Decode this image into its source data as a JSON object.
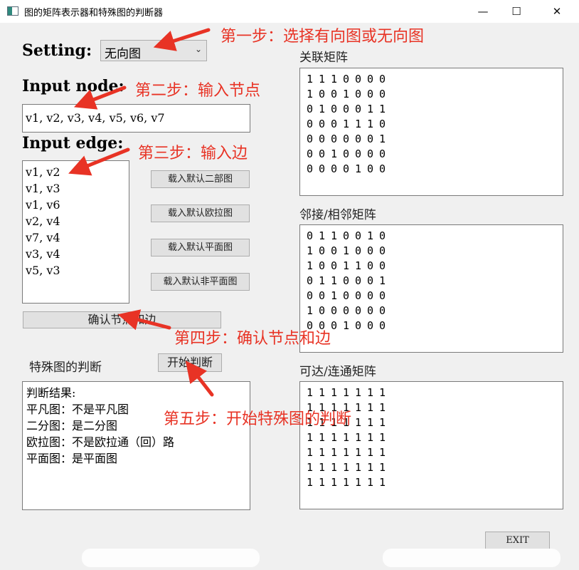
{
  "window": {
    "title": "图的矩阵表示器和特殊图的判断器",
    "minimize_glyph": "—",
    "maximize_glyph": "☐",
    "close_glyph": "✕",
    "icon": "app-window-icon"
  },
  "setting": {
    "label": "Setting:",
    "value": "无向图",
    "dropdown_icon": "chevron-down-icon"
  },
  "node": {
    "label": "Input node:",
    "value": "v1, v2, v3, v4, v5, v6, v7"
  },
  "edge": {
    "label": "Input edge:",
    "value": "v1, v2\nv1, v3\nv1, v6\nv2, v4\nv7, v4\nv3, v4\nv5, v3"
  },
  "buttons": {
    "load_bipartite": "载入默认二部图",
    "load_euler": "载入默认欧拉图",
    "load_planar": "载入默认平面图",
    "load_nonplanar": "载入默认非平面图",
    "confirm": "确认节点和边",
    "start": "开始判断",
    "exit": "EXIT"
  },
  "special": {
    "label": "特殊图的判断",
    "result": "判断结果:\n平凡图：不是平凡图\n二分图：是二分图\n欧拉图：不是欧拉通（回）路\n平面图：是平面图"
  },
  "matrices": {
    "incidence": {
      "label": "关联矩阵",
      "rows": [
        [
          1,
          1,
          1,
          0,
          0,
          0,
          0
        ],
        [
          1,
          0,
          0,
          1,
          0,
          0,
          0
        ],
        [
          0,
          1,
          0,
          0,
          0,
          1,
          1
        ],
        [
          0,
          0,
          0,
          1,
          1,
          1,
          0
        ],
        [
          0,
          0,
          0,
          0,
          0,
          0,
          1
        ],
        [
          0,
          0,
          1,
          0,
          0,
          0,
          0
        ],
        [
          0,
          0,
          0,
          0,
          1,
          0,
          0
        ]
      ]
    },
    "adjacency": {
      "label": "邻接/相邻矩阵",
      "rows": [
        [
          0,
          1,
          1,
          0,
          0,
          1,
          0
        ],
        [
          1,
          0,
          0,
          1,
          0,
          0,
          0
        ],
        [
          1,
          0,
          0,
          1,
          1,
          0,
          0
        ],
        [
          0,
          1,
          1,
          0,
          0,
          0,
          1
        ],
        [
          0,
          0,
          1,
          0,
          0,
          0,
          0
        ],
        [
          1,
          0,
          0,
          0,
          0,
          0,
          0
        ],
        [
          0,
          0,
          0,
          1,
          0,
          0,
          0
        ]
      ]
    },
    "reachability": {
      "label": "可达/连通矩阵",
      "rows": [
        [
          1,
          1,
          1,
          1,
          1,
          1,
          1
        ],
        [
          1,
          1,
          1,
          1,
          1,
          1,
          1
        ],
        [
          1,
          1,
          1,
          1,
          1,
          1,
          1
        ],
        [
          1,
          1,
          1,
          1,
          1,
          1,
          1
        ],
        [
          1,
          1,
          1,
          1,
          1,
          1,
          1
        ],
        [
          1,
          1,
          1,
          1,
          1,
          1,
          1
        ],
        [
          1,
          1,
          1,
          1,
          1,
          1,
          1
        ]
      ]
    }
  },
  "annotations": {
    "step1": "第一步：选择有向图或无向图",
    "step2": "第二步：输入节点",
    "step3": "第三步：输入边",
    "step4": "第四步：确认节点和边",
    "step5": "第五步：开始特殊图的判断",
    "color": "#e83325"
  }
}
